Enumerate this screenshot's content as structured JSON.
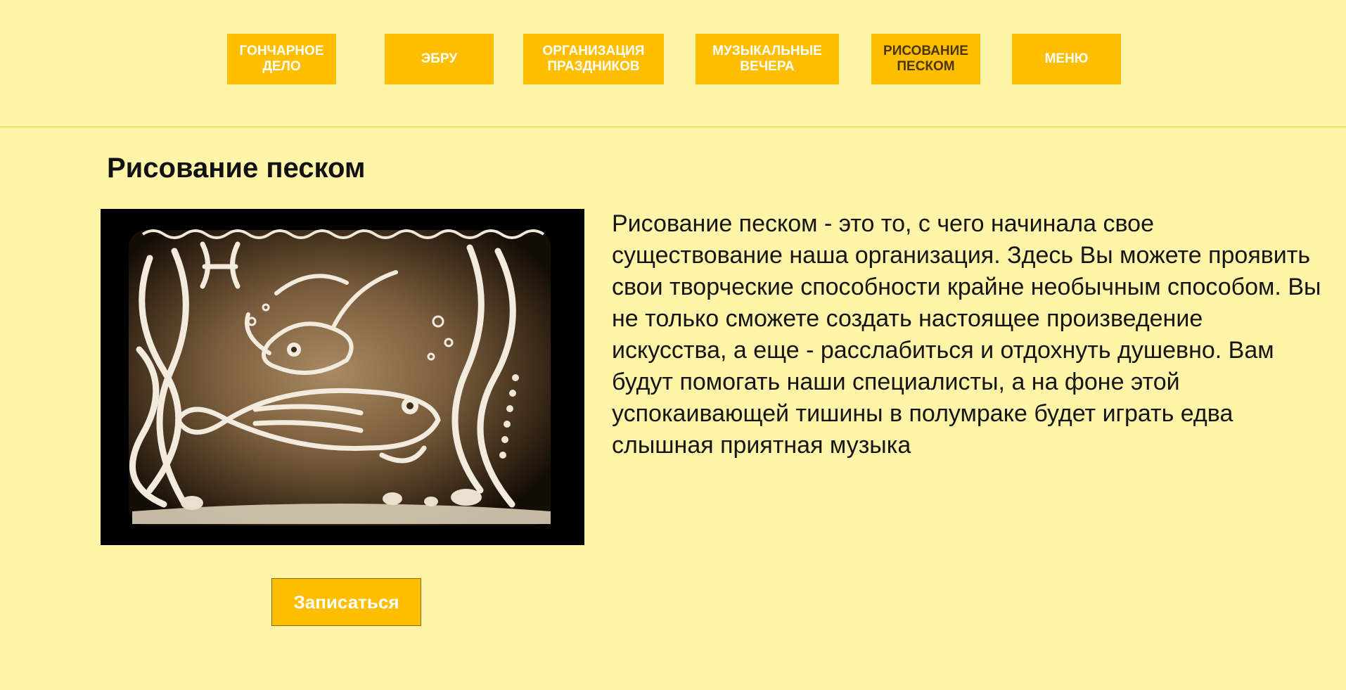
{
  "nav": {
    "items": [
      {
        "label_line1": "ГОНЧАРНОЕ",
        "label_line2": "ДЕЛО"
      },
      {
        "label_line1": "ЭБРУ",
        "label_line2": ""
      },
      {
        "label_line1": "ОРГАНИЗАЦИЯ",
        "label_line2": "ПРАЗДНИКОВ"
      },
      {
        "label_line1": "МУЗЫКАЛЬНЫЕ",
        "label_line2": "ВЕЧЕРА"
      },
      {
        "label_line1": "РИСОВАНИЕ",
        "label_line2": "ПЕСКОМ"
      },
      {
        "label_line1": "МЕНЮ",
        "label_line2": ""
      }
    ],
    "active_index": 4
  },
  "main": {
    "title": "Рисование песком",
    "description": "Рисование песком - это то, с чего начинала свое существование наша организация. Здесь Вы можете проявить свои творческие способности крайне необычным способом. Вы не только сможете создать настоящее произведение искусства, а еще - расслабиться и отдохнуть душевно. Вам будут помогать наши специалисты, а на фоне этой успокаивающей тишины в полумраке будет играть едва слышная приятная музыка",
    "signup_button": "Записаться"
  },
  "colors": {
    "page_background": "#fff4a8",
    "button_background": "#ffbf00",
    "button_text": "#ffffff",
    "active_nav_text": "#4a3600"
  }
}
